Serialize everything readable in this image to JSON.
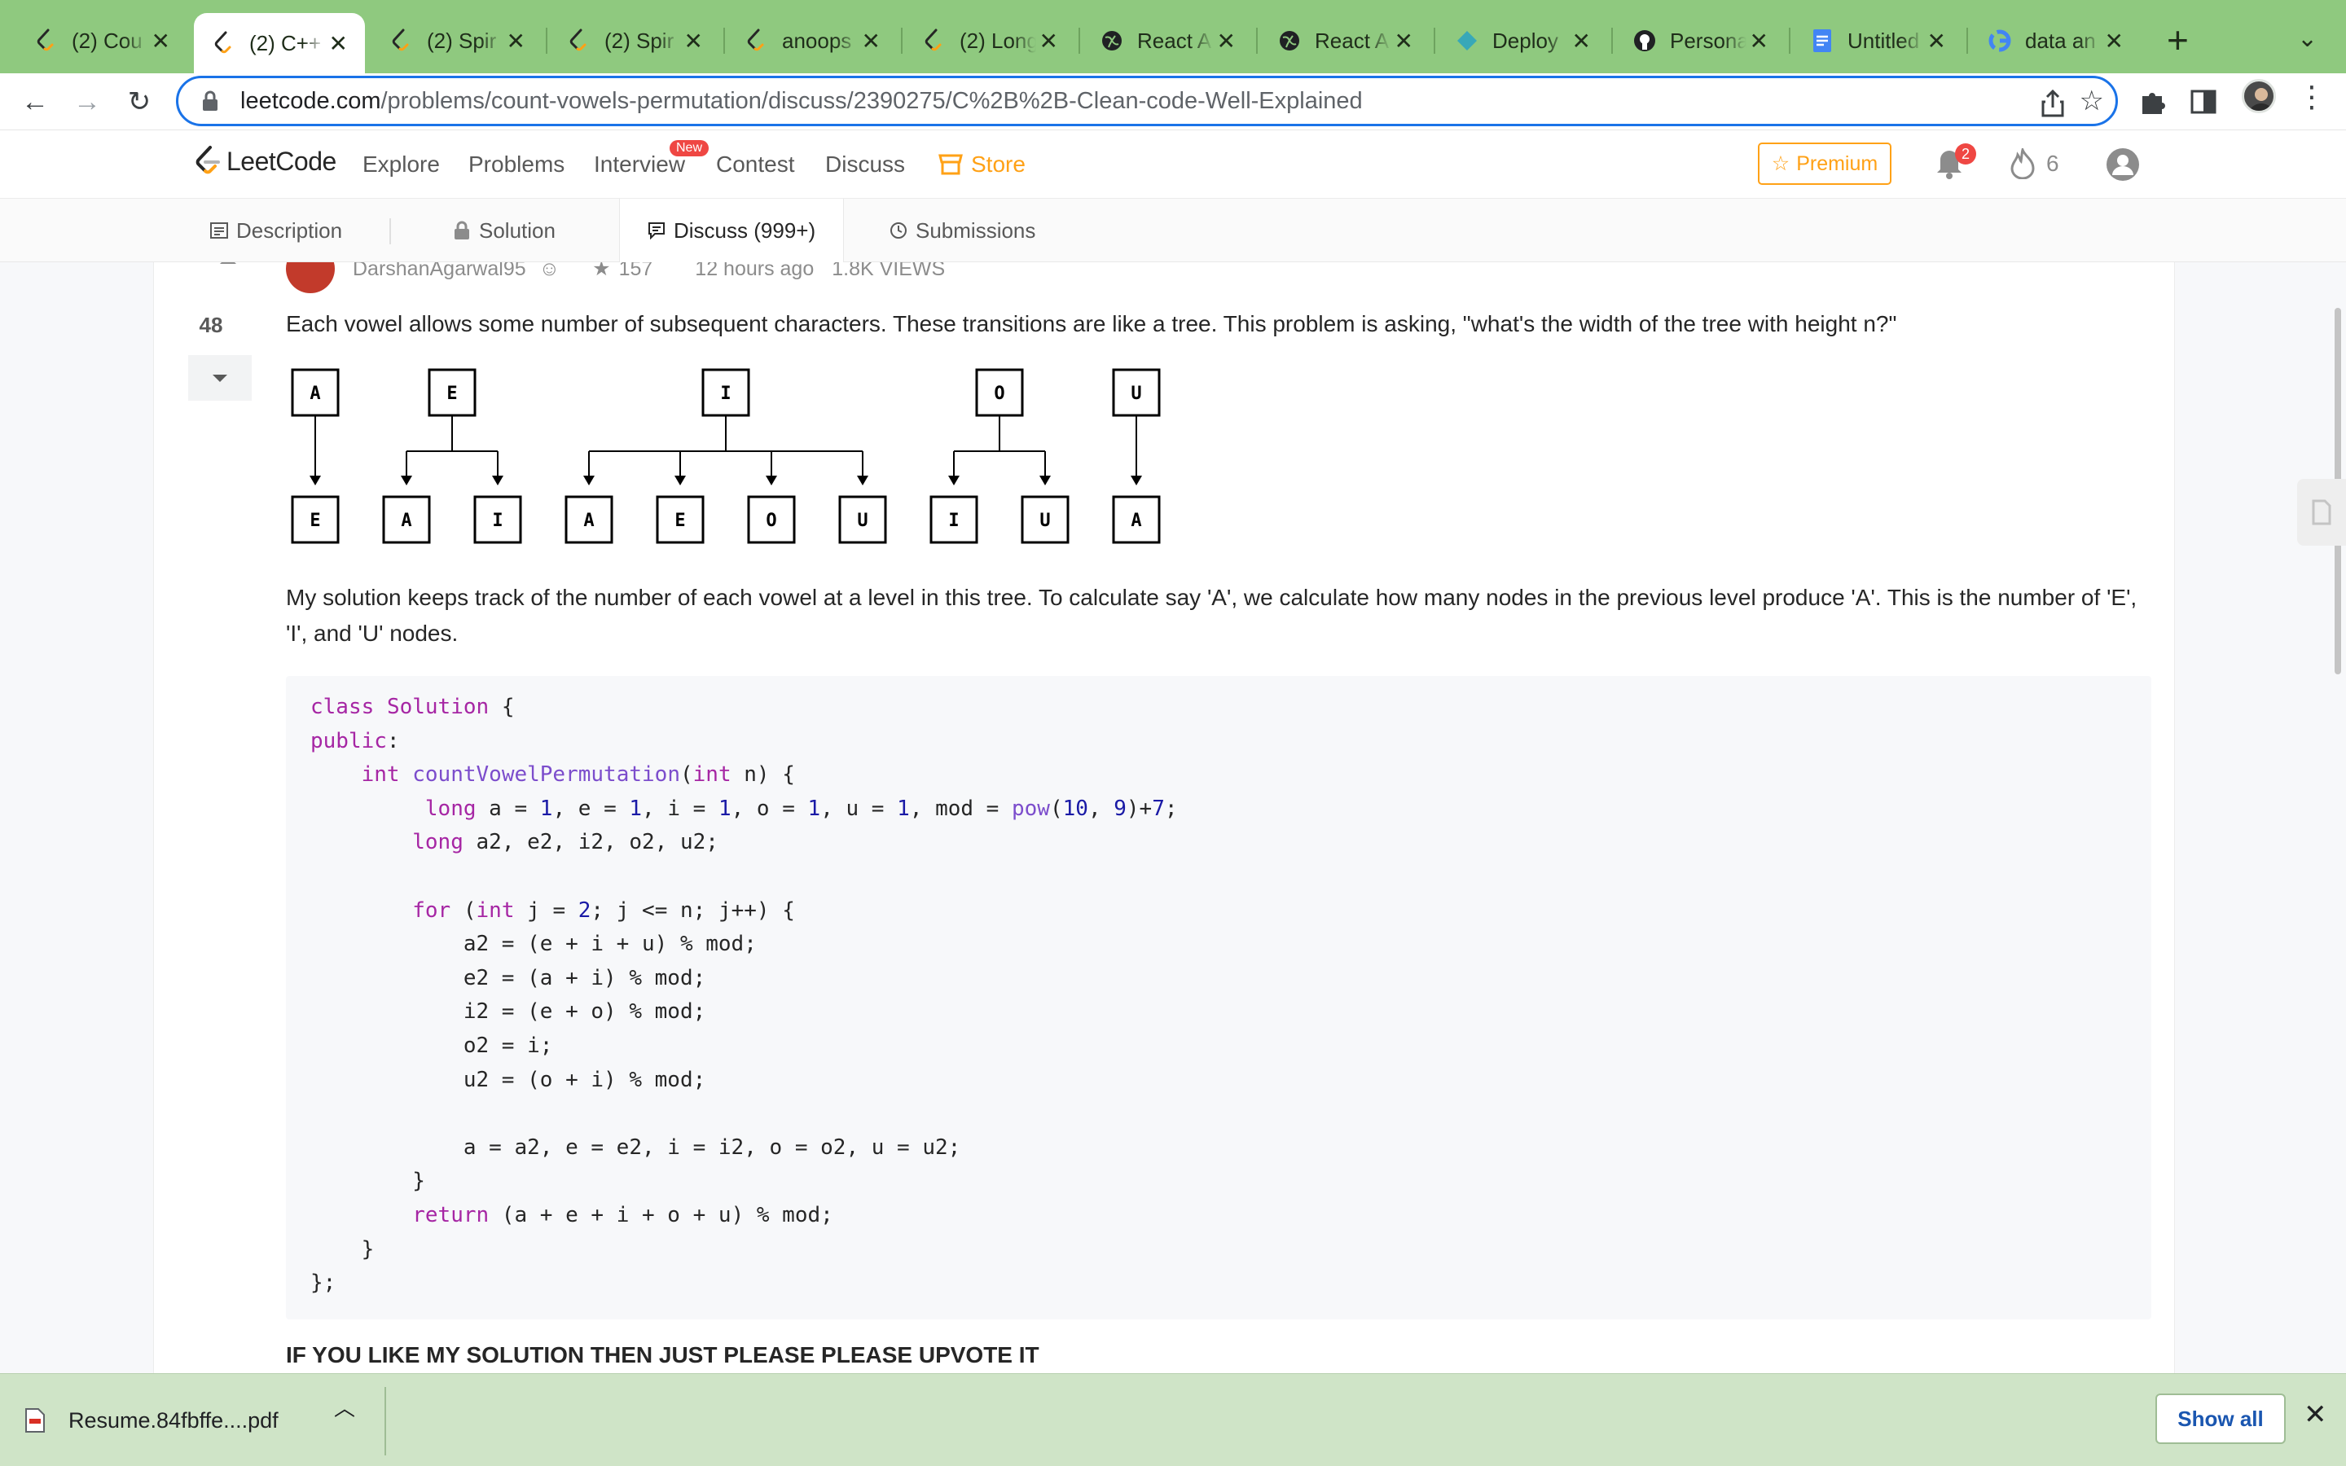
{
  "browser": {
    "tabs": [
      {
        "label": "(2) Cou",
        "icon": "leetcode"
      },
      {
        "label": "(2) C++",
        "icon": "leetcode"
      },
      {
        "label": "(2) Spir",
        "icon": "leetcode"
      },
      {
        "label": "(2) Spir",
        "icon": "leetcode"
      },
      {
        "label": "anoops",
        "icon": "leetcode"
      },
      {
        "label": "(2) Long",
        "icon": "leetcode"
      },
      {
        "label": "React A",
        "icon": "globe"
      },
      {
        "label": "React A",
        "icon": "globe"
      },
      {
        "label": "Deploy",
        "icon": "diamond"
      },
      {
        "label": "Persona",
        "icon": "github"
      },
      {
        "label": "Untitled",
        "icon": "docs"
      },
      {
        "label": "data an",
        "icon": "google"
      }
    ],
    "active_tab_index": 1,
    "tab_close_glyph": "✕",
    "new_tab_glyph": "+",
    "url_host": "leetcode.com",
    "url_path": "/problems/count-vowels-permutation/discuss/2390275/C%2B%2B-Clean-code-Well-Explained"
  },
  "lc": {
    "logo_text": "LeetCode",
    "nav": {
      "explore": "Explore",
      "problems": "Problems",
      "interview": "Interview",
      "new_badge": "New",
      "contest": "Contest",
      "discuss": "Discuss",
      "store": "Store"
    },
    "premium": "Premium",
    "notification_count": "2",
    "streak": "6",
    "tabs": {
      "description": "Description",
      "solution": "Solution",
      "discuss": "Discuss (999+)",
      "submissions": "Submissions"
    },
    "accent": "#ffa116"
  },
  "post": {
    "author": "DarshanAgarwal95",
    "reputation": "157",
    "time": "12 hours ago",
    "views": "1.8K VIEWS",
    "votes": "48",
    "intro": "Each vowel allows some number of subsequent characters. These transitions are like a tree. This problem is asking, \"what's the width of the tree with height n?\"",
    "tree": [
      {
        "parent": "A",
        "children": [
          "E"
        ]
      },
      {
        "parent": "E",
        "children": [
          "A",
          "I"
        ]
      },
      {
        "parent": "I",
        "children": [
          "A",
          "E",
          "O",
          "U"
        ]
      },
      {
        "parent": "O",
        "children": [
          "I",
          "U"
        ]
      },
      {
        "parent": "U",
        "children": [
          "A"
        ]
      }
    ],
    "explanation": "My solution keeps track of the number of each vowel at a level in this tree. To calculate say 'A', we calculate how many nodes in the previous level produce 'A'. This is the number of 'E', 'I', and 'U' nodes.",
    "code_lines": [
      "class Solution {",
      "public:",
      "    int countVowelPermutation(int n) {",
      "         long a = 1, e = 1, i = 1, o = 1, u = 1, mod = pow(10, 9)+7;",
      "        long a2, e2, i2, o2, u2;",
      "",
      "        for (int j = 2; j <= n; j++) {",
      "            a2 = (e + i + u) % mod;",
      "            e2 = (a + i) % mod;",
      "            i2 = (e + o) % mod;",
      "            o2 = i;",
      "            u2 = (o + i) % mod;",
      "",
      "            a = a2, e = e2, i = i2, o = o2, u = u2;",
      "        }",
      "        return (a + e + i + o + u) % mod;",
      "    }",
      "};"
    ],
    "footer": "IF YOU LIKE MY SOLUTION THEN JUST PLEASE PLEASE UPVOTE IT"
  },
  "downloads": {
    "file": "Resume.84fbffe....pdf",
    "show_all": "Show all"
  }
}
